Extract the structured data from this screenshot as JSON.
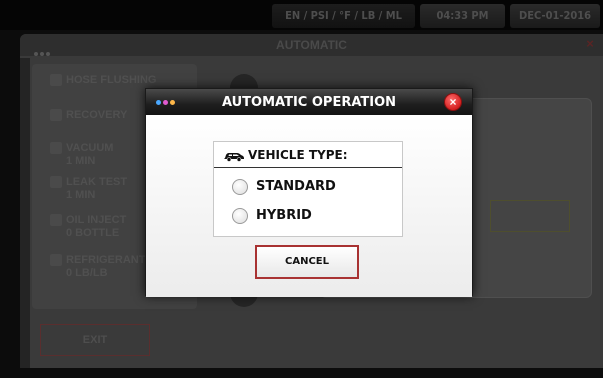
{
  "status_bar": {
    "units": "EN / PSI / °F / LB / ML",
    "time": "04:33 PM",
    "date": "DEC-01-2016"
  },
  "background_window": {
    "title": "AUTOMATIC",
    "close_glyph": "×",
    "menu_items": [
      {
        "label": "HOSE FLUSHING",
        "icon": "hose-icon"
      },
      {
        "label": "RECOVERY",
        "icon": "recovery-icon"
      },
      {
        "label": "VACUUM",
        "sub": "1 MIN",
        "icon": "vacuum-icon"
      },
      {
        "label": "LEAK TEST",
        "sub": "1 MIN",
        "icon": "leak-test-icon"
      },
      {
        "label": "OIL INJECT",
        "sub": "0 BOTTLE",
        "icon": "oil-icon"
      },
      {
        "label": "REFRIGERANT",
        "sub": "0 LB/LB",
        "icon": "refrigerant-icon"
      }
    ],
    "exit_label": "EXIT"
  },
  "modal": {
    "title": "AUTOMATIC OPERATION",
    "close_glyph": "×",
    "title_dots_colors": [
      "#4aa8ff",
      "#e05ad0",
      "#ffb84a"
    ],
    "vehicle_type_label": "VEHICLE TYPE:",
    "vehicle_icon": "car-icon",
    "options": [
      {
        "label": "STANDARD",
        "selected": false
      },
      {
        "label": "HYBRID",
        "selected": false
      }
    ],
    "cancel_label": "CANCEL"
  },
  "colors": {
    "modal_close": "#d42020",
    "cancel_border": "#a83232",
    "title_bar": "#1e1e1e"
  }
}
